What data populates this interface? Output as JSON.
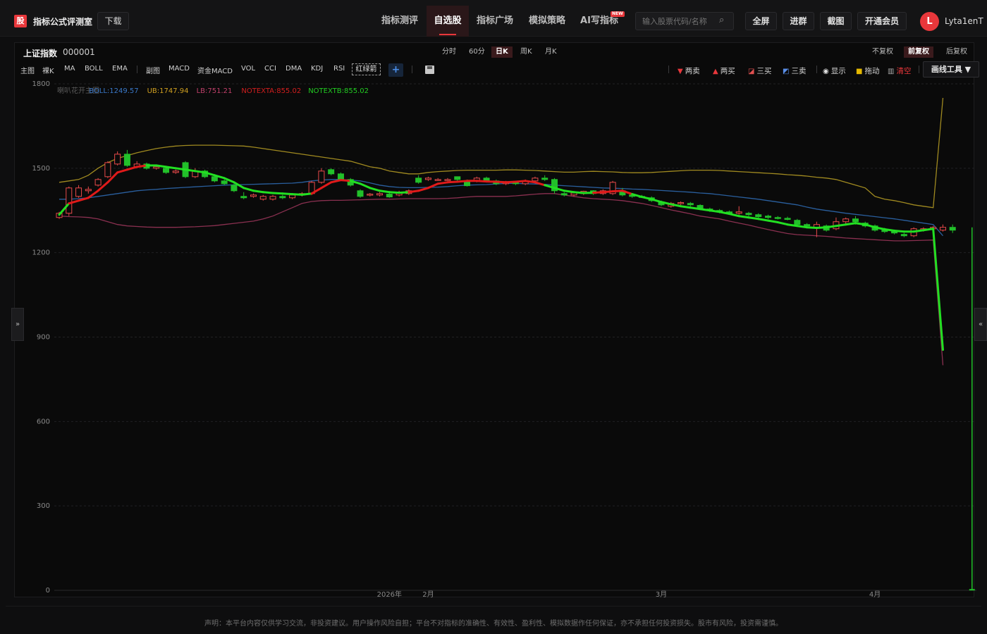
{
  "header": {
    "logo_text": "股",
    "app_title": "指标公式评测室",
    "download": "下载",
    "nav": [
      {
        "label": "指标测评",
        "active": false
      },
      {
        "label": "自选股",
        "active": true
      },
      {
        "label": "指标广场",
        "active": false
      },
      {
        "label": "模拟策略",
        "active": false
      },
      {
        "label": "AI写指标",
        "active": false
      }
    ],
    "new_badge": "NEW",
    "search_placeholder": "输入股票代码/名称",
    "buttons": {
      "fullscreen": "全屏",
      "join_group": "进群",
      "screenshot": "截图",
      "vip": "开通会员"
    },
    "avatar_letter": "L",
    "username": "Lyta1enT"
  },
  "stock": {
    "name": "上证指数",
    "code": "000001"
  },
  "periods": [
    {
      "label": "分时",
      "active": false
    },
    {
      "label": "60分",
      "active": false
    },
    {
      "label": "日K",
      "active": true
    },
    {
      "label": "周K",
      "active": false
    },
    {
      "label": "月K",
      "active": false
    }
  ],
  "adjust": [
    {
      "label": "不复权",
      "active": false
    },
    {
      "label": "前复权",
      "active": true
    },
    {
      "label": "后复权",
      "active": false
    }
  ],
  "indicators_left": [
    "主图",
    "裸K",
    "MA",
    "BOLL",
    "EMA"
  ],
  "indicators_right": [
    "副图",
    "MACD",
    "资金MACD",
    "VOL",
    "CCI",
    "DMA",
    "KDJ",
    "RSI"
  ],
  "redgreen_label": "红绿箭",
  "plus_label": "+",
  "tools": {
    "two_sell": "两卖",
    "two_buy": "两买",
    "three_buy": "三买",
    "three_sell": "三卖",
    "show": "显示",
    "drag": "拖动",
    "clear": "清空",
    "draw_tools": "画线工具 ▼"
  },
  "toggles": {
    "left": "»",
    "right": "«"
  },
  "disclaimer": "声明：本平台内容仅供学习交流，非投资建议。用户操作风险自担；平台不对指标的准确性、有效性、盈利性、模拟数据作任何保证，亦不承担任何投资损失。股市有风险，投资需谨慎。",
  "chart_data": {
    "type": "candlestick",
    "legend": [
      {
        "text": "喇叭花开主图",
        "color": "#5a5a5a"
      },
      {
        "text": "BOLL:1249.57",
        "color": "#3a78c8"
      },
      {
        "text": "UB:1747.94",
        "color": "#d0a020"
      },
      {
        "text": "LB:751.21",
        "color": "#c0406a"
      },
      {
        "text": "NOTEXTA:855.02",
        "color": "#d21e1e"
      },
      {
        "text": "NOTEXTB:855.02",
        "color": "#22cc22"
      }
    ],
    "y_ticks": [
      1800,
      1500,
      1200,
      900,
      600,
      300,
      0
    ],
    "ylim": [
      0,
      1800
    ],
    "x_ticks": [
      {
        "label": "2026年",
        "index": 34
      },
      {
        "label": "2月",
        "index": 38
      },
      {
        "label": "3月",
        "index": 62
      },
      {
        "label": "4月",
        "index": 84
      }
    ],
    "n": 95,
    "candles": [
      [
        1325,
        1340,
        1320,
        1345
      ],
      [
        1340,
        1430,
        1330,
        1435
      ],
      [
        1400,
        1430,
        1395,
        1440
      ],
      [
        1420,
        1425,
        1410,
        1435
      ],
      [
        1440,
        1460,
        1435,
        1465
      ],
      [
        1470,
        1520,
        1465,
        1525
      ],
      [
        1515,
        1550,
        1510,
        1560
      ],
      [
        1550,
        1510,
        1505,
        1565
      ],
      [
        1505,
        1515,
        1500,
        1525
      ],
      [
        1515,
        1500,
        1495,
        1520
      ],
      [
        1500,
        1505,
        1495,
        1510
      ],
      [
        1500,
        1485,
        1480,
        1505
      ],
      [
        1485,
        1490,
        1480,
        1495
      ],
      [
        1520,
        1470,
        1465,
        1525
      ],
      [
        1470,
        1490,
        1465,
        1500
      ],
      [
        1490,
        1470,
        1465,
        1495
      ],
      [
        1470,
        1455,
        1450,
        1475
      ],
      [
        1455,
        1445,
        1440,
        1460
      ],
      [
        1440,
        1420,
        1415,
        1445
      ],
      [
        1400,
        1395,
        1390,
        1415
      ],
      [
        1400,
        1405,
        1395,
        1410
      ],
      [
        1390,
        1400,
        1385,
        1405
      ],
      [
        1390,
        1400,
        1385,
        1405
      ],
      [
        1400,
        1395,
        1390,
        1405
      ],
      [
        1395,
        1405,
        1390,
        1410
      ],
      [
        1405,
        1410,
        1400,
        1415
      ],
      [
        1410,
        1450,
        1405,
        1455
      ],
      [
        1450,
        1490,
        1445,
        1500
      ],
      [
        1495,
        1480,
        1475,
        1500
      ],
      [
        1480,
        1460,
        1455,
        1485
      ],
      [
        1460,
        1440,
        1435,
        1465
      ],
      [
        1420,
        1400,
        1395,
        1425
      ],
      [
        1405,
        1408,
        1400,
        1412
      ],
      [
        1405,
        1410,
        1400,
        1415
      ],
      [
        1408,
        1398,
        1395,
        1412
      ],
      [
        1405,
        1415,
        1400,
        1420
      ],
      [
        1410,
        1420,
        1405,
        1425
      ],
      [
        1465,
        1450,
        1445,
        1475
      ],
      [
        1460,
        1465,
        1455,
        1470
      ],
      [
        1460,
        1460,
        1455,
        1465
      ],
      [
        1460,
        1460,
        1455,
        1465
      ],
      [
        1470,
        1460,
        1455,
        1470
      ],
      [
        1455,
        1438,
        1435,
        1460
      ],
      [
        1455,
        1465,
        1450,
        1470
      ],
      [
        1465,
        1455,
        1450,
        1470
      ],
      [
        1455,
        1445,
        1440,
        1460
      ],
      [
        1445,
        1450,
        1440,
        1455
      ],
      [
        1450,
        1445,
        1440,
        1455
      ],
      [
        1445,
        1455,
        1440,
        1460
      ],
      [
        1455,
        1465,
        1450,
        1470
      ],
      [
        1465,
        1460,
        1455,
        1475
      ],
      [
        1460,
        1420,
        1410,
        1465
      ],
      [
        1410,
        1405,
        1400,
        1415
      ],
      [
        1405,
        1412,
        1400,
        1418
      ],
      [
        1410,
        1418,
        1405,
        1420
      ],
      [
        1420,
        1410,
        1405,
        1422
      ],
      [
        1410,
        1420,
        1405,
        1425
      ],
      [
        1410,
        1450,
        1405,
        1455
      ],
      [
        1420,
        1405,
        1400,
        1430
      ],
      [
        1405,
        1400,
        1395,
        1410
      ],
      [
        1400,
        1398,
        1395,
        1405
      ],
      [
        1395,
        1385,
        1380,
        1400
      ],
      [
        1380,
        1370,
        1365,
        1385
      ],
      [
        1365,
        1375,
        1360,
        1380
      ],
      [
        1375,
        1378,
        1370,
        1382
      ],
      [
        1375,
        1370,
        1365,
        1380
      ],
      [
        1368,
        1358,
        1352,
        1372
      ],
      [
        1355,
        1350,
        1345,
        1360
      ],
      [
        1350,
        1345,
        1340,
        1355
      ],
      [
        1345,
        1340,
        1335,
        1350
      ],
      [
        1340,
        1345,
        1335,
        1365
      ],
      [
        1340,
        1335,
        1330,
        1345
      ],
      [
        1335,
        1328,
        1324,
        1340
      ],
      [
        1330,
        1325,
        1320,
        1335
      ],
      [
        1325,
        1322,
        1318,
        1330
      ],
      [
        1322,
        1318,
        1315,
        1328
      ],
      [
        1315,
        1300,
        1295,
        1320
      ],
      [
        1300,
        1295,
        1290,
        1305
      ],
      [
        1290,
        1300,
        1255,
        1310
      ],
      [
        1295,
        1280,
        1275,
        1300
      ],
      [
        1285,
        1310,
        1280,
        1325
      ],
      [
        1310,
        1320,
        1300,
        1325
      ],
      [
        1320,
        1310,
        1300,
        1330
      ],
      [
        1305,
        1295,
        1290,
        1310
      ],
      [
        1295,
        1280,
        1275,
        1300
      ],
      [
        1280,
        1275,
        1270,
        1288
      ],
      [
        1275,
        1270,
        1265,
        1282
      ],
      [
        1265,
        1260,
        1255,
        1270
      ],
      [
        1260,
        1285,
        1255,
        1290
      ],
      [
        1280,
        1285,
        1275,
        1290
      ],
      [
        1285,
        1290,
        1280,
        1295
      ],
      [
        1280,
        1290,
        1275,
        1300
      ],
      [
        1290,
        1280,
        1270,
        1300
      ]
    ],
    "ub": [
      1450,
      1455,
      1460,
      1475,
      1500,
      1520,
      1535,
      1545,
      1555,
      1563,
      1570,
      1575,
      1579,
      1581,
      1582,
      1582,
      1582,
      1581,
      1580,
      1579,
      1575,
      1570,
      1565,
      1560,
      1555,
      1550,
      1545,
      1540,
      1535,
      1530,
      1525,
      1515,
      1505,
      1500,
      1490,
      1485,
      1480,
      1480,
      1485,
      1488,
      1490,
      1492,
      1493,
      1493,
      1493,
      1493,
      1494,
      1494,
      1493,
      1492,
      1490,
      1488,
      1486,
      1486,
      1488,
      1489,
      1488,
      1487,
      1485,
      1484,
      1484,
      1485,
      1487,
      1489,
      1491,
      1493,
      1493,
      1493,
      1492,
      1490,
      1488,
      1486,
      1484,
      1482,
      1480,
      1477,
      1475,
      1472,
      1468,
      1465,
      1460,
      1450,
      1440,
      1430,
      1400,
      1390,
      1385,
      1378,
      1370,
      1365,
      1360,
      1750
    ],
    "mid": [
      1390,
      1390,
      1392,
      1395,
      1400,
      1405,
      1410,
      1415,
      1420,
      1423,
      1425,
      1428,
      1430,
      1432,
      1434,
      1436,
      1438,
      1440,
      1441,
      1442,
      1443,
      1444,
      1445,
      1446,
      1447,
      1450,
      1455,
      1458,
      1460,
      1460,
      1458,
      1455,
      1448,
      1440,
      1435,
      1432,
      1431,
      1431,
      1432,
      1433,
      1435,
      1438,
      1440,
      1441,
      1442,
      1444,
      1446,
      1446,
      1445,
      1444,
      1443,
      1440,
      1438,
      1436,
      1434,
      1432,
      1430,
      1429,
      1428,
      1426,
      1425,
      1423,
      1421,
      1419,
      1417,
      1415,
      1412,
      1410,
      1406,
      1402,
      1398,
      1394,
      1390,
      1385,
      1380,
      1375,
      1370,
      1362,
      1355,
      1350,
      1345,
      1340,
      1336,
      1332,
      1328,
      1324,
      1320,
      1315,
      1310,
      1305,
      1300,
      1260
    ],
    "lb": [
      1330,
      1328,
      1327,
      1325,
      1320,
      1310,
      1300,
      1295,
      1293,
      1291,
      1290,
      1290,
      1290,
      1291,
      1292,
      1294,
      1296,
      1300,
      1304,
      1308,
      1312,
      1320,
      1330,
      1345,
      1360,
      1375,
      1382,
      1385,
      1386,
      1386,
      1387,
      1388,
      1389,
      1390,
      1390,
      1391,
      1392,
      1392,
      1392,
      1392,
      1393,
      1395,
      1398,
      1400,
      1400,
      1400,
      1400,
      1402,
      1405,
      1408,
      1410,
      1410,
      1405,
      1400,
      1395,
      1392,
      1390,
      1388,
      1385,
      1380,
      1375,
      1368,
      1360,
      1352,
      1345,
      1338,
      1330,
      1325,
      1320,
      1312,
      1305,
      1298,
      1290,
      1282,
      1275,
      1268,
      1264,
      1262,
      1260,
      1258,
      1255,
      1252,
      1250,
      1248,
      1246,
      1244,
      1242,
      1242,
      1243,
      1244,
      1245,
      800
    ],
    "notext": [
      1335,
      1375,
      1385,
      1395,
      1420,
      1450,
      1485,
      1495,
      1505,
      1510,
      1510,
      1505,
      1500,
      1495,
      1490,
      1485,
      1475,
      1465,
      1450,
      1430,
      1420,
      1415,
      1412,
      1410,
      1408,
      1406,
      1410,
      1430,
      1450,
      1458,
      1455,
      1445,
      1430,
      1420,
      1415,
      1413,
      1415,
      1420,
      1430,
      1445,
      1450,
      1452,
      1455,
      1455,
      1453,
      1452,
      1450,
      1452,
      1455,
      1450,
      1440,
      1430,
      1420,
      1415,
      1412,
      1413,
      1415,
      1418,
      1420,
      1408,
      1398,
      1390,
      1380,
      1372,
      1365,
      1360,
      1355,
      1350,
      1345,
      1338,
      1330,
      1325,
      1320,
      1314,
      1308,
      1300,
      1295,
      1290,
      1288,
      1290,
      1295,
      1300,
      1305,
      1300,
      1290,
      1283,
      1278,
      1275,
      1275,
      1280,
      1285,
      855
    ],
    "notext_color": [
      1,
      0,
      0,
      0,
      0,
      0,
      0,
      0,
      0,
      1,
      1,
      1,
      1,
      1,
      1,
      1,
      1,
      1,
      1,
      1,
      1,
      1,
      1,
      1,
      1,
      1,
      0,
      0,
      0,
      0,
      1,
      1,
      1,
      1,
      1,
      1,
      0,
      0,
      0,
      0,
      0,
      0,
      0,
      0,
      0,
      0,
      0,
      0,
      0,
      0,
      1,
      1,
      1,
      1,
      1,
      0,
      0,
      0,
      0,
      1,
      1,
      1,
      1,
      1,
      1,
      1,
      1,
      1,
      1,
      1,
      1,
      1,
      1,
      1,
      1,
      1,
      1,
      1,
      1,
      1,
      1,
      1,
      1,
      1,
      1,
      1,
      1,
      1,
      1,
      1,
      1,
      1
    ]
  }
}
